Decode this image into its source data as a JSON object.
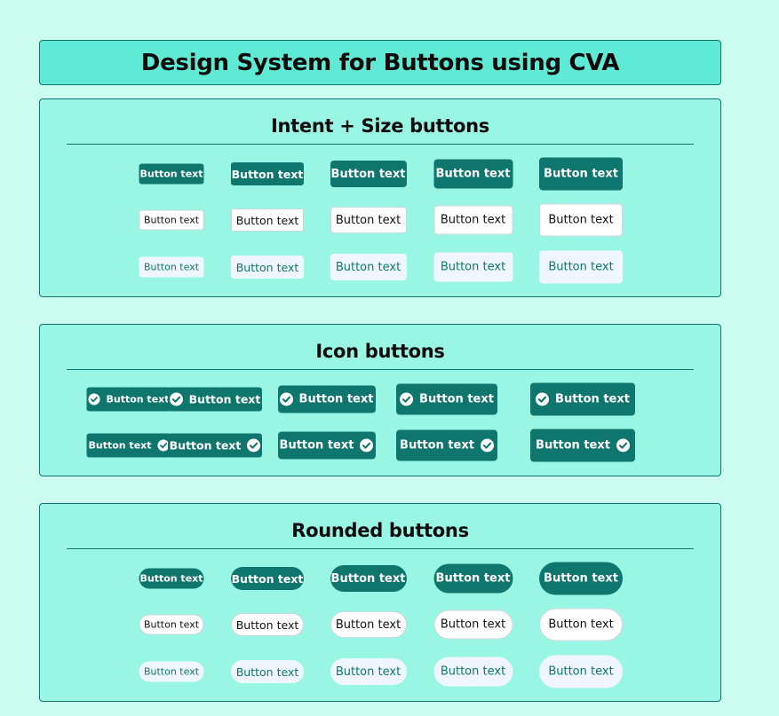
{
  "page": {
    "title": "Design System for Buttons using CVA"
  },
  "colors": {
    "background": "#ccfbef",
    "header": "#5eead4",
    "panel": "#99f6e4",
    "primary": "#0f766e",
    "secondary": "#ffffff",
    "tertiary": "#eff6ff"
  },
  "sections": [
    {
      "heading": "Intent + Size buttons",
      "rows": [
        {
          "intent": "primary",
          "labels": [
            "Button text",
            "Button text",
            "Button text",
            "Button text",
            "Button text"
          ]
        },
        {
          "intent": "secondary",
          "labels": [
            "Button text",
            "Button text",
            "Button text",
            "Button text",
            "Button text"
          ]
        },
        {
          "intent": "tertiary",
          "labels": [
            "Button text",
            "Button text",
            "Button text",
            "Button text",
            "Button text"
          ]
        }
      ]
    },
    {
      "heading": "Icon buttons",
      "rows": [
        {
          "intent": "primary",
          "icon": "check-circle-icon",
          "icon_position": "left",
          "labels": [
            "Button text",
            "Button text",
            "Button text",
            "Button text",
            "Button text"
          ]
        },
        {
          "intent": "primary",
          "icon": "check-circle-icon",
          "icon_position": "right",
          "labels": [
            "Button text",
            "Button text",
            "Button text",
            "Button text",
            "Button text"
          ]
        }
      ]
    },
    {
      "heading": "Rounded buttons",
      "rows": [
        {
          "intent": "primary",
          "labels": [
            "Button text",
            "Button text",
            "Button text",
            "Button text",
            "Button text"
          ]
        },
        {
          "intent": "secondary",
          "labels": [
            "Button text",
            "Button text",
            "Button text",
            "Button text",
            "Button text"
          ]
        },
        {
          "intent": "tertiary",
          "labels": [
            "Button text",
            "Button text",
            "Button text",
            "Button text",
            "Button text"
          ]
        }
      ]
    }
  ]
}
